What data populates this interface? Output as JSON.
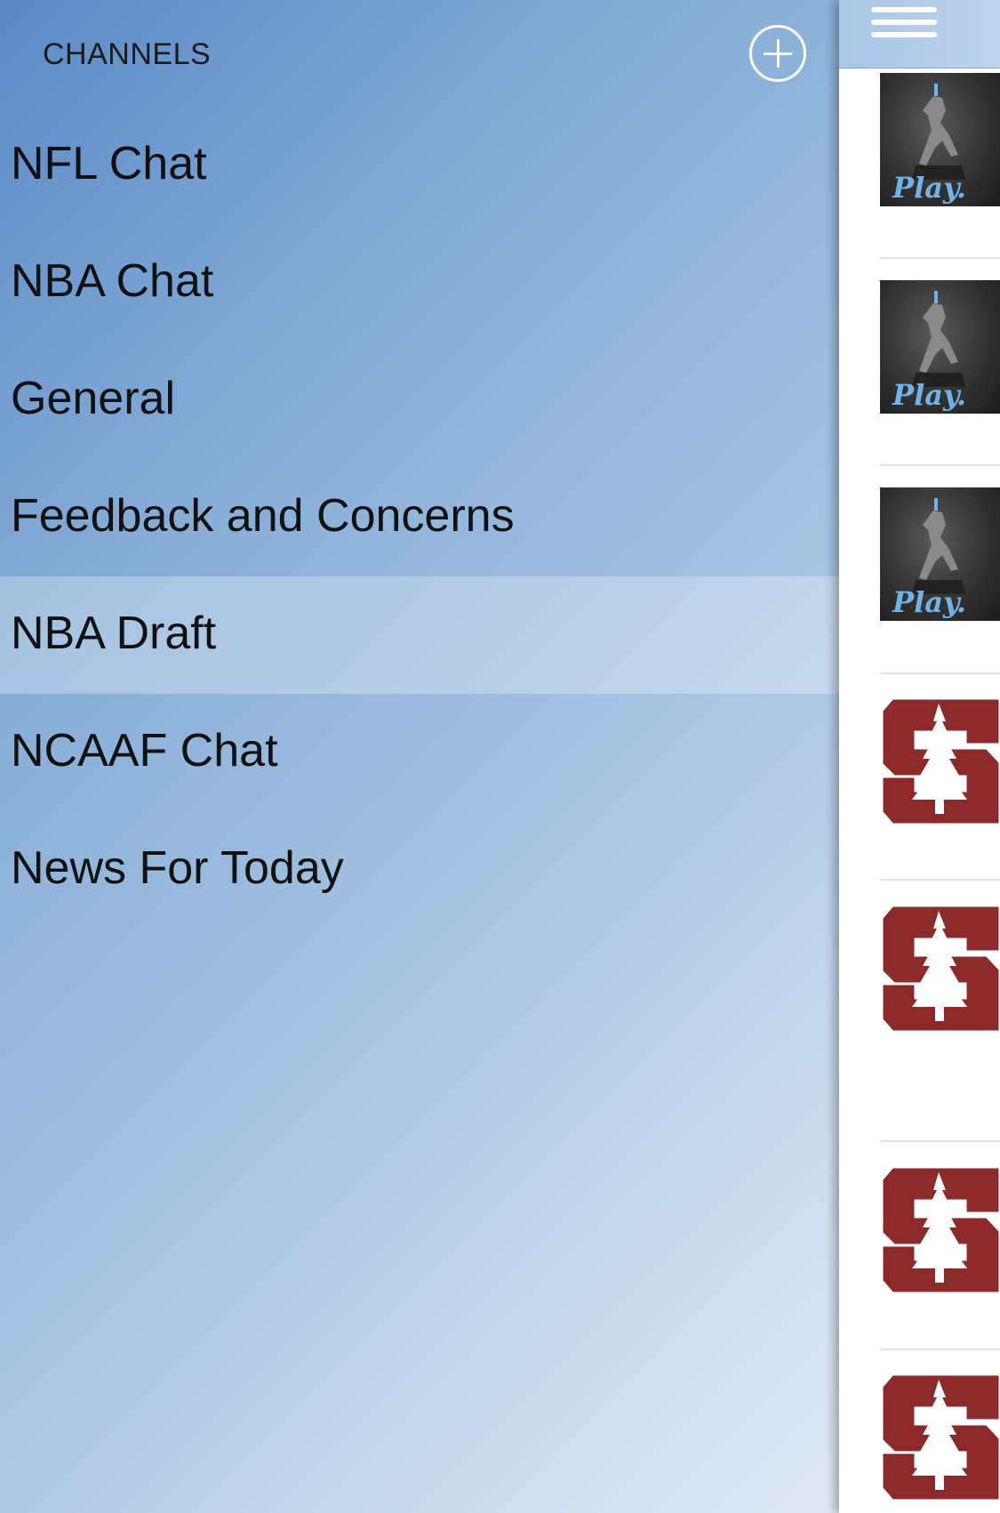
{
  "drawer": {
    "title": "CHANNELS",
    "add_button_icon": "plus-circle-icon",
    "channels": [
      {
        "label": "NFL Chat",
        "selected": false
      },
      {
        "label": "NBA Chat",
        "selected": false
      },
      {
        "label": "General",
        "selected": false
      },
      {
        "label": "Feedback and Concerns",
        "selected": false
      },
      {
        "label": "NBA Draft",
        "selected": true
      },
      {
        "label": "NCAAF Chat",
        "selected": false
      },
      {
        "label": "News For Today",
        "selected": false
      }
    ]
  },
  "feed": {
    "menu_icon": "hamburger-menu-icon",
    "thumbnails": [
      {
        "type": "play-trophy",
        "logo_text": "Play."
      },
      {
        "type": "play-trophy",
        "logo_text": "Play."
      },
      {
        "type": "play-trophy",
        "logo_text": "Play."
      },
      {
        "type": "stanford-s"
      },
      {
        "type": "stanford-s"
      },
      {
        "type": "stanford-s"
      },
      {
        "type": "stanford-s"
      }
    ]
  },
  "colors": {
    "stanford_cardinal": "#8c2a2a",
    "play_blue": "#6fb3e8"
  }
}
